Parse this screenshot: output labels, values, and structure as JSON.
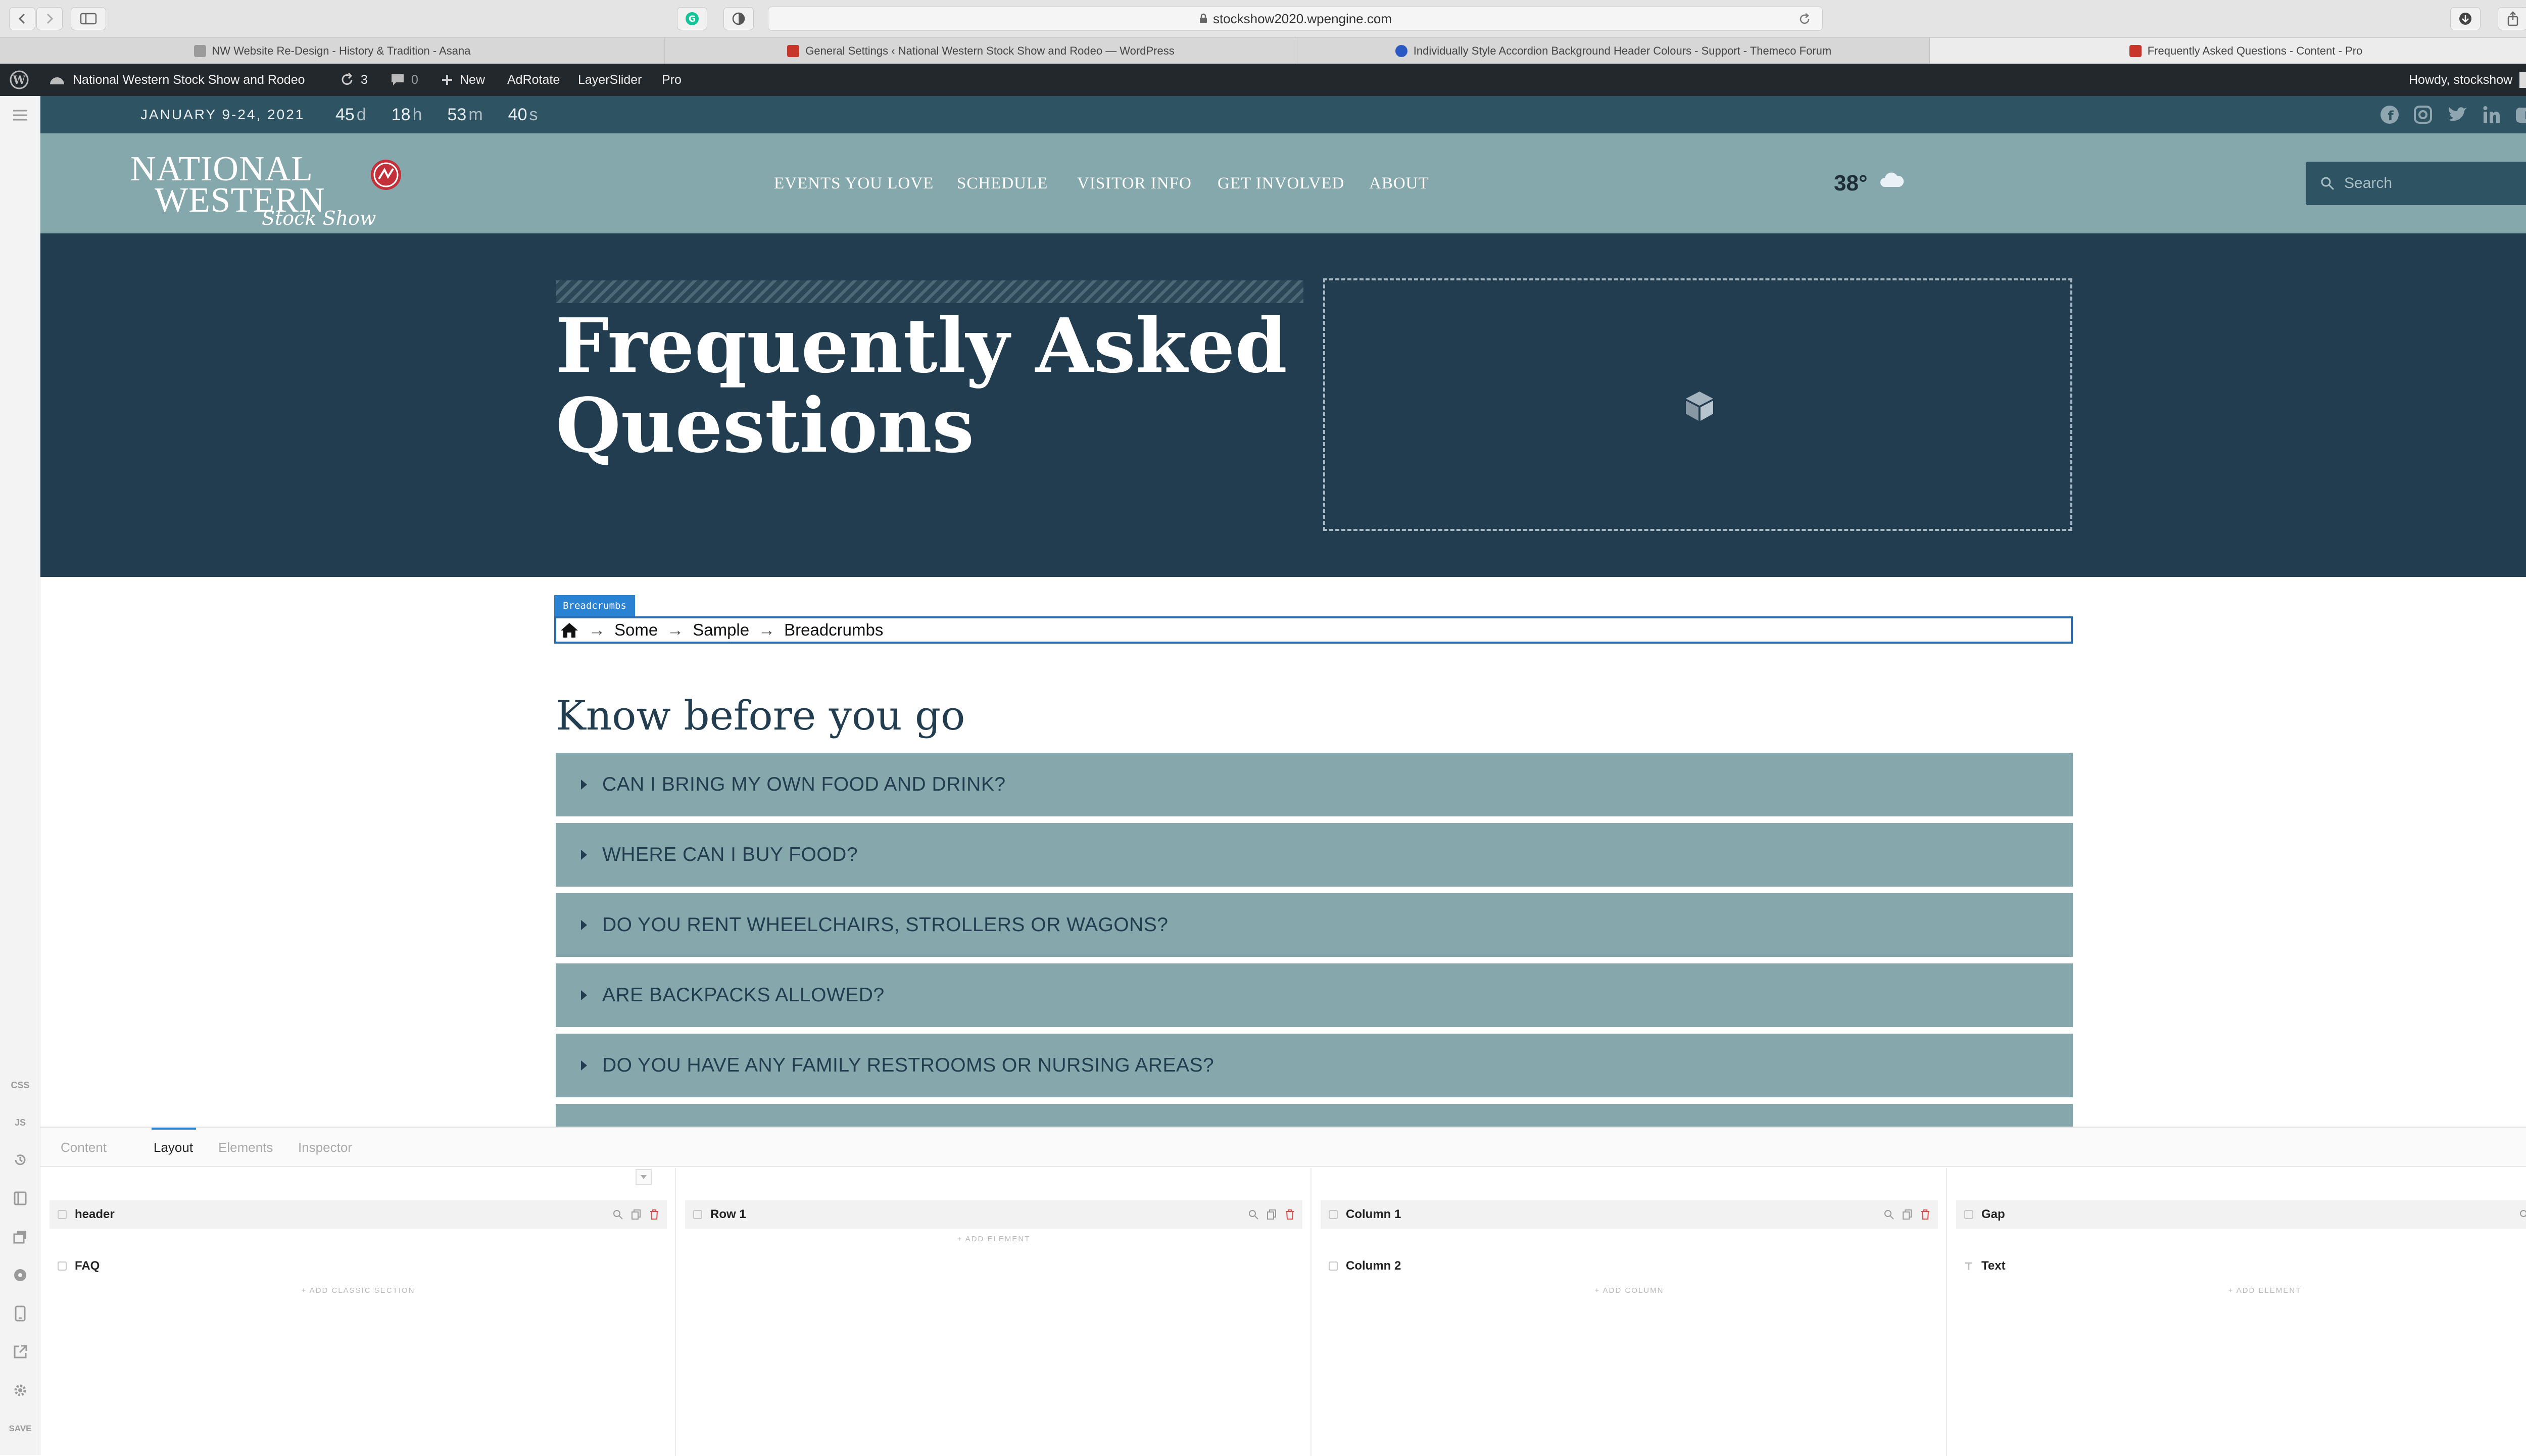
{
  "browser": {
    "url": "stockshow2020.wpengine.com",
    "tabs": [
      {
        "label": "NW Website Re-Design - History & Tradition - Asana",
        "fav_color": "#9b9b9b"
      },
      {
        "label": "General Settings ‹ National Western Stock Show and Rodeo — WordPress",
        "fav_color": "#c8352b"
      },
      {
        "label": "Individually Style Accordion Background Header Colours - Support - Themeco Forum",
        "fav_color": "#2b59c3"
      },
      {
        "label": "Frequently Asked Questions - Content - Pro",
        "fav_color": "#c8352b"
      }
    ],
    "new_tab_label": "+"
  },
  "admin_bar": {
    "site_name": "National Western Stock Show and Rodeo",
    "updates_count": "3",
    "comments_count": "0",
    "new_label": "New",
    "adrotate_label": "AdRotate",
    "layerslider_label": "LayerSlider",
    "pro_label": "Pro",
    "howdy_label": "Howdy, stockshow"
  },
  "rail": {
    "css_label": "CSS",
    "js_label": "JS",
    "save_label": "SAVE"
  },
  "site": {
    "topbar": {
      "dates": "JANUARY 9-24, 2021",
      "countdown": [
        {
          "value": "45",
          "unit": "d"
        },
        {
          "value": "18",
          "unit": "h"
        },
        {
          "value": "53",
          "unit": "m"
        },
        {
          "value": "40",
          "unit": "s"
        }
      ]
    },
    "logo": {
      "line1": "NATIONAL",
      "line2": "WESTERN",
      "script": "Stock Show"
    },
    "nav": [
      "EVENTS YOU LOVE",
      "SCHEDULE",
      "VISITOR INFO",
      "GET INVOLVED",
      "ABOUT"
    ],
    "weather": {
      "temp": "38°"
    },
    "search": {
      "placeholder": "Search"
    },
    "hero": {
      "title_line1": "Frequently Asked",
      "title_line2": "Questions"
    },
    "breadcrumbs": {
      "tag": "Breadcrumbs",
      "items": [
        "Some",
        "Sample",
        "Breadcrumbs"
      ],
      "separator": "→"
    },
    "faq": {
      "heading": "Know before you go",
      "items": [
        "CAN I BRING MY OWN FOOD AND DRINK?",
        "WHERE CAN I BUY FOOD?",
        "DO YOU RENT WHEELCHAIRS, STROLLERS OR WAGONS?",
        "ARE BACKPACKS ALLOWED?",
        "DO YOU HAVE ANY FAMILY RESTROOMS OR NURSING AREAS?"
      ]
    }
  },
  "builder": {
    "tabs": [
      "Content",
      "Layout",
      "Elements",
      "Inspector"
    ],
    "active_tab": "Layout",
    "columns": [
      {
        "selected": "header",
        "child": "FAQ",
        "add_label": "+ ADD CLASSIC SECTION"
      },
      {
        "selected": "Row 1",
        "child": "",
        "add_label": "+ ADD ELEMENT"
      },
      {
        "selected": "Column 1",
        "child": "Column 2",
        "add_label": "+ ADD COLUMN"
      },
      {
        "selected": "Gap",
        "child": "Text",
        "add_label": "+ ADD ELEMENT"
      }
    ]
  },
  "colors": {
    "topbar": "#2e5363",
    "nav": "#85a8ad",
    "hero": "#223d4f",
    "accordion": "#86a7ab",
    "accent": "#2a83d2",
    "delete": "#e04b4b"
  }
}
